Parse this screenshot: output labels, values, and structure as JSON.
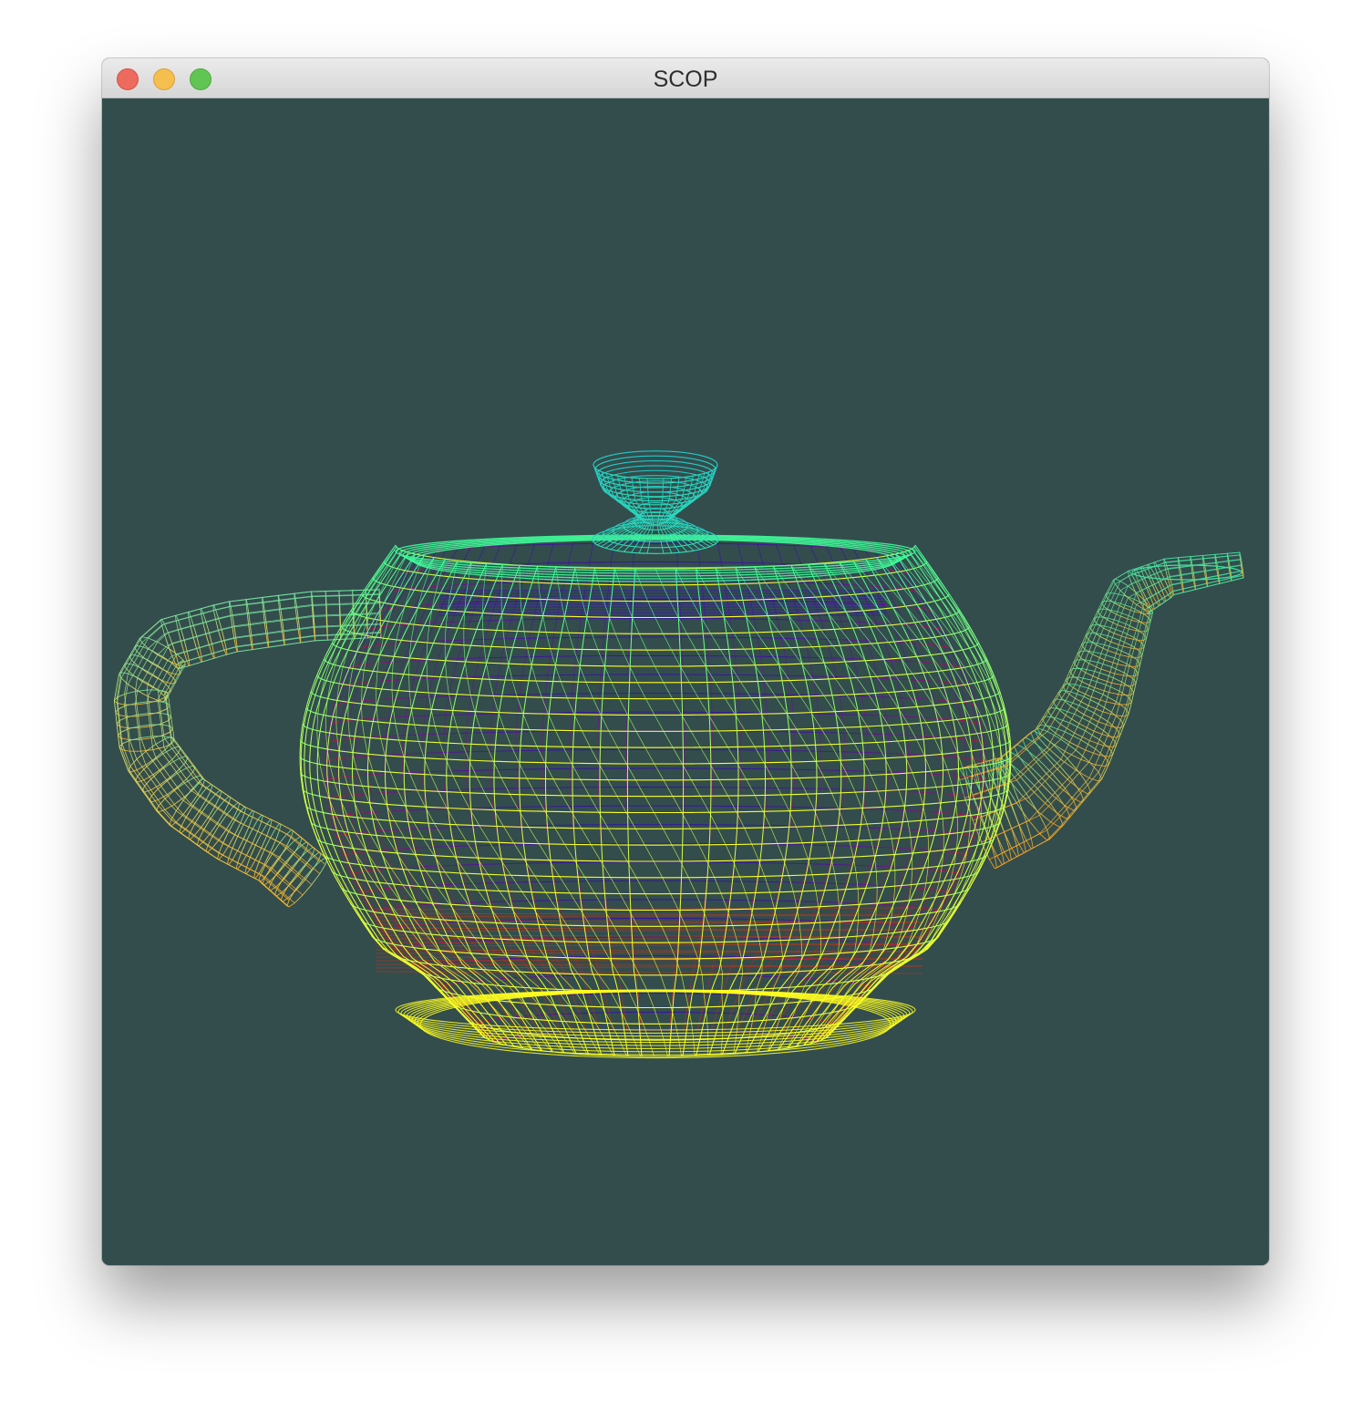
{
  "window": {
    "title": "SCOP",
    "buttons": [
      "close",
      "minimize",
      "zoom"
    ],
    "background_color": "#334d4d"
  },
  "viewport": {
    "content": "teapot-wireframe",
    "colors": {
      "top": "#40ff9a",
      "lid": "#20c8c8",
      "mid": "#c8ff40",
      "bottom": "#ffff20",
      "interior_top": "#3000c0",
      "interior_bottom": "#ff0000"
    }
  }
}
